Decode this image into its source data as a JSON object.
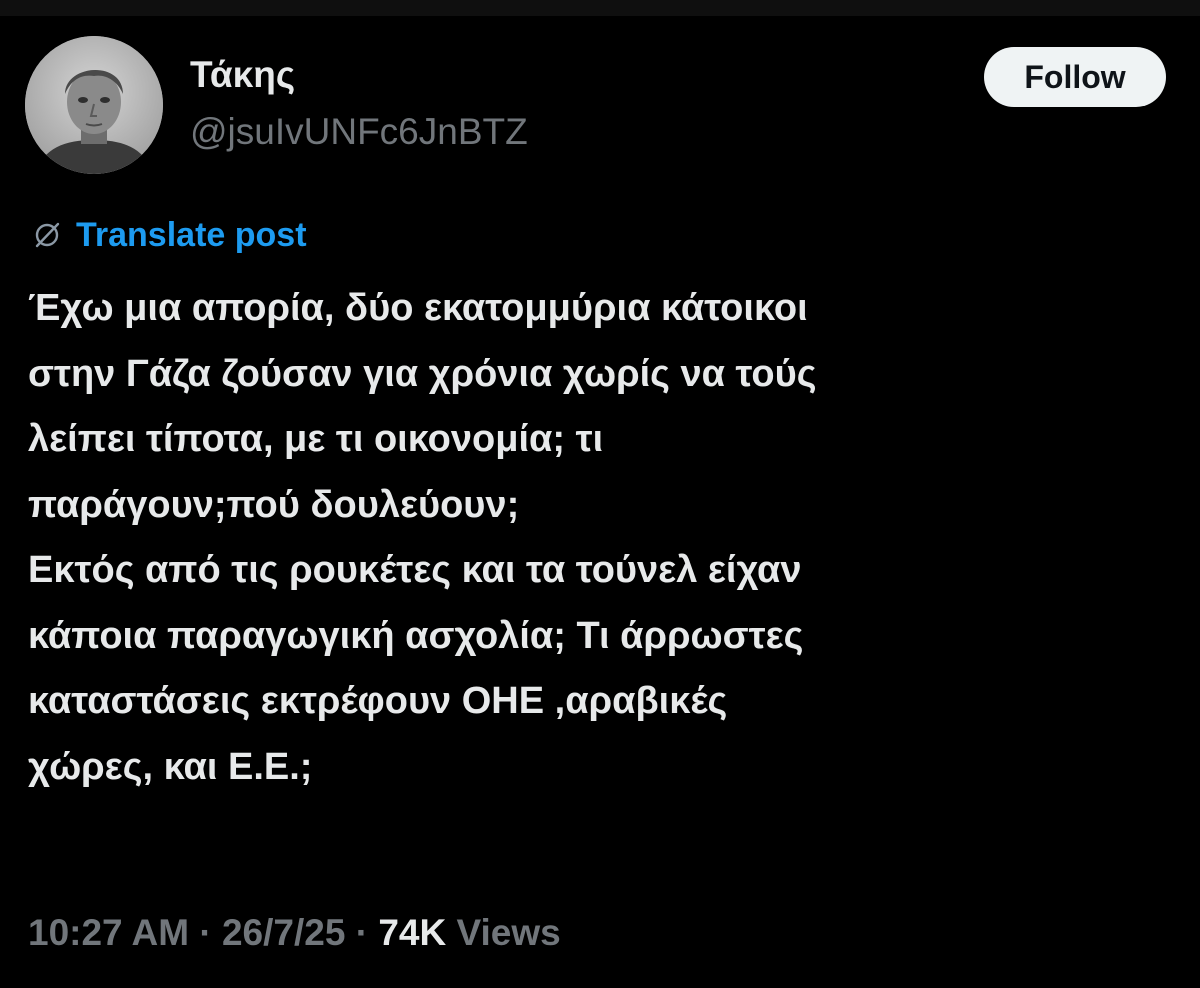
{
  "author": {
    "display_name": "Τάκης",
    "handle": "@jsuIvUNFc6JnBTZ",
    "avatar_icon": "user-photo-avatar"
  },
  "follow_button": {
    "label": "Follow"
  },
  "translate": {
    "label": "Translate post",
    "icon": "globe-slash-icon",
    "color": "#1d9bf0"
  },
  "post": {
    "lines": [
      "Έχω μια απορία, δύο εκατομμύρια κάτοικοι",
      "στην Γάζα ζούσαν για χρόνια χωρίς να τούς",
      "λείπει τίποτα, με τι οικονομία; τι",
      "παράγουν;πού δουλεύουν;",
      "Εκτός από τις ρουκέτες και τα τούνελ είχαν",
      "κάποια παραγωγική ασχολία; Τι άρρωστες",
      "καταστάσεις εκτρέφουν ΟΗΕ ,αραβικές",
      "χώρες, και Ε.Ε.;"
    ]
  },
  "meta": {
    "time": "10:27 AM",
    "separator": " · ",
    "date": "26/7/25",
    "views_count": "74K",
    "views_label": " Views"
  },
  "colors": {
    "background": "#000000",
    "text_primary": "#e7e9ea",
    "text_secondary": "#71767b",
    "accent": "#1d9bf0",
    "button_bg": "#eff3f4"
  }
}
